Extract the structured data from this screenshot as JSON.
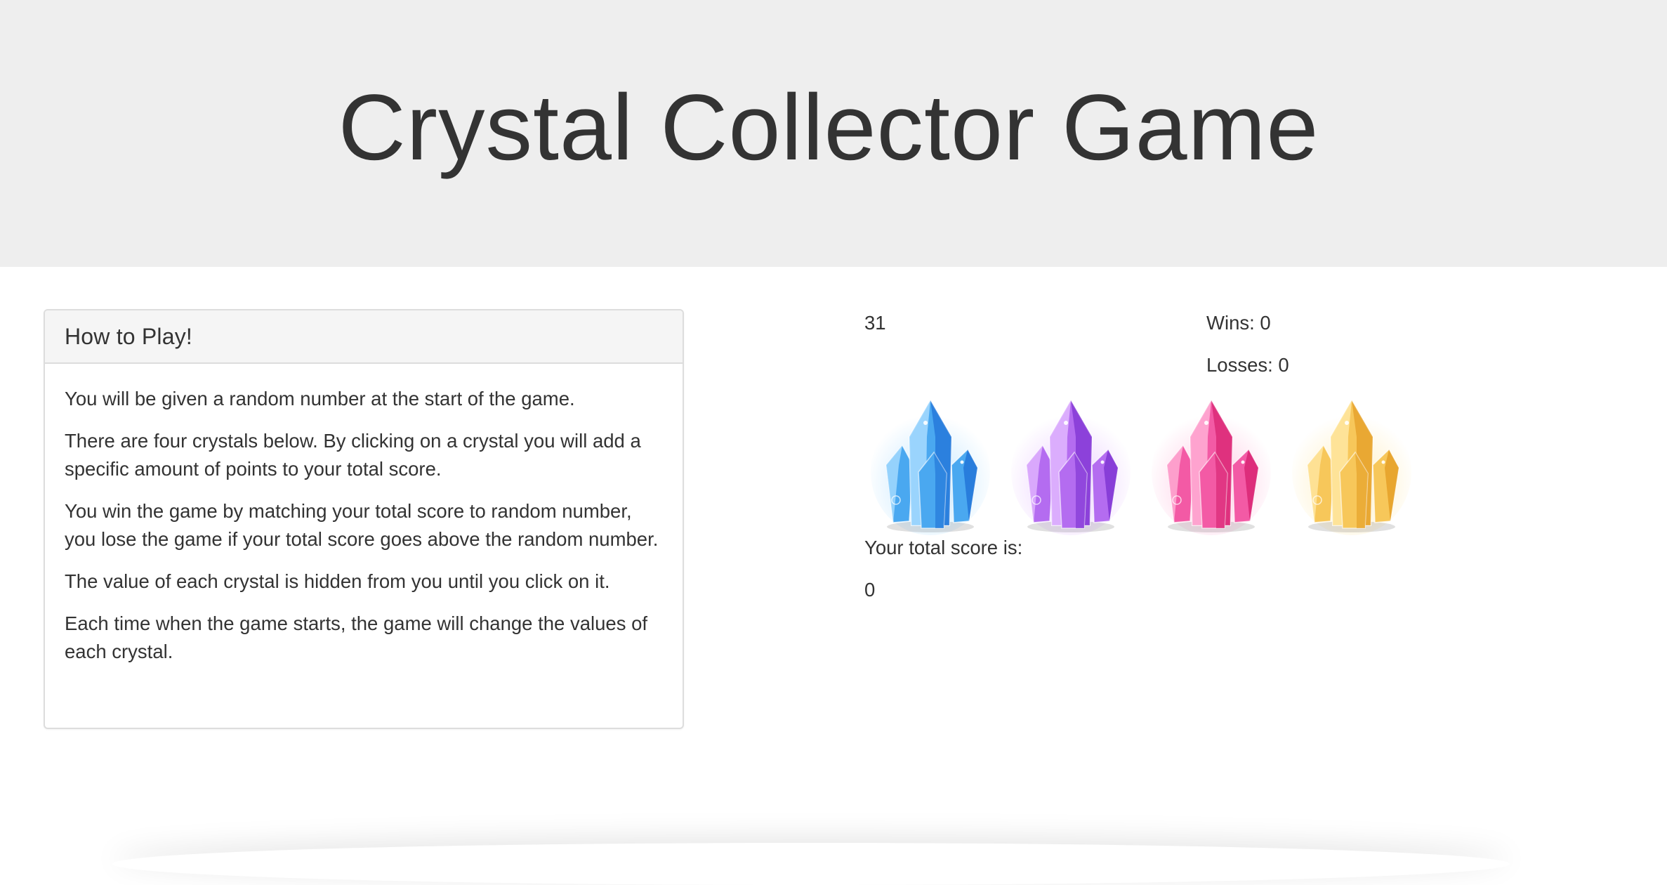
{
  "header": {
    "title": "Crystal Collector Game"
  },
  "instructions": {
    "heading": "How to Play!",
    "paragraphs": [
      "You will be given a random number at the start of the game.",
      "There are four crystals below. By clicking on a crystal you will add a specific amount of points to your total score.",
      "You win the game by matching your total score to random number, you lose the game if your total score goes above the random number.",
      "The value of each crystal is hidden from you until you click on it.",
      "Each time when the game starts, the game will change the values of each crystal."
    ]
  },
  "game": {
    "target_number": "31",
    "wins_text": "Wins: 0",
    "losses_text": "Losses: 0",
    "score_label": "Your total score is:",
    "total_score": "0",
    "crystals": [
      {
        "icon": "blue-crystal-icon",
        "color_light": "#a8dcff",
        "color_mid": "#4aa8f0",
        "color_dark": "#1e6fd6"
      },
      {
        "icon": "purple-crystal-icon",
        "color_light": "#e2b8ff",
        "color_mid": "#b46cf0",
        "color_dark": "#7a2fd0"
      },
      {
        "icon": "pink-crystal-icon",
        "color_light": "#ffb0d6",
        "color_mid": "#f35aa5",
        "color_dark": "#d61f6e"
      },
      {
        "icon": "yellow-crystal-icon",
        "color_light": "#ffe7a3",
        "color_mid": "#f7c75a",
        "color_dark": "#e39b22"
      }
    ]
  },
  "colors": {
    "header_bg": "#eeeeee",
    "panel_heading_bg": "#f5f5f5",
    "panel_border": "#dddddd",
    "text": "#333333"
  }
}
